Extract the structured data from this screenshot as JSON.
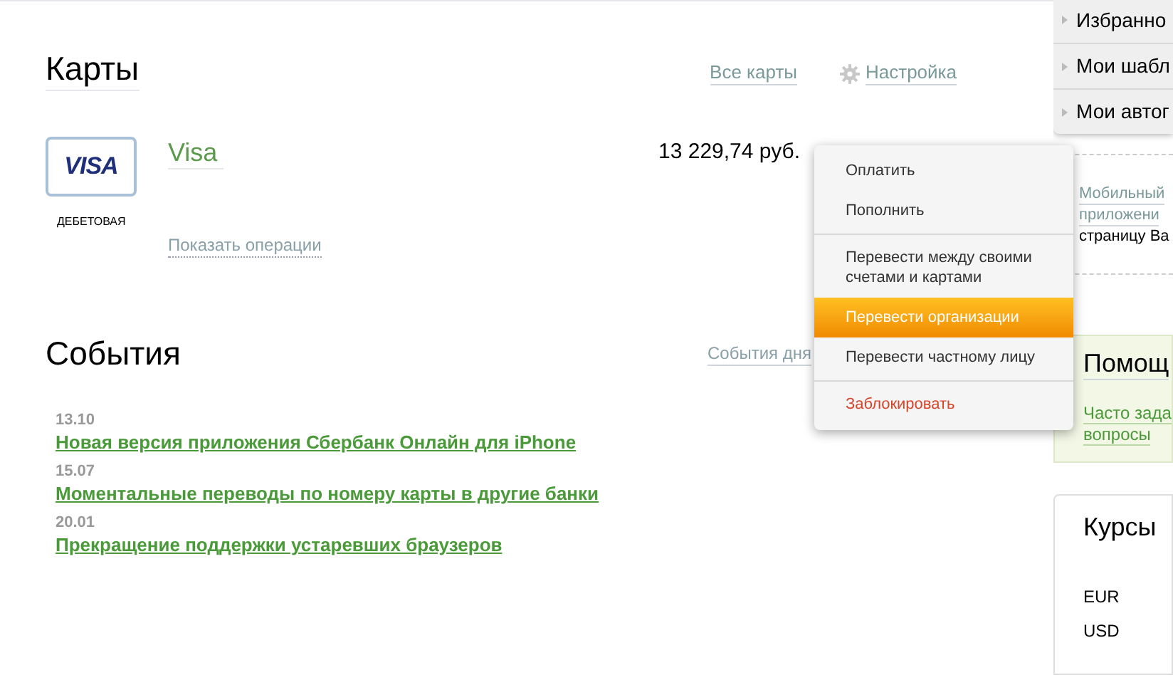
{
  "cards_section": {
    "title": "Карты",
    "links": [
      {
        "label": "Все карты",
        "kind": "plain"
      },
      {
        "label": "Настройка",
        "kind": "settings"
      }
    ],
    "cards": [
      {
        "brand_logo": "VISA",
        "name": "Visa",
        "type": "ДЕБЕТОВАЯ",
        "balance": "13 229,74 руб.",
        "operations_link": "Показать операции"
      }
    ]
  },
  "card_menu": {
    "groups": [
      [
        {
          "label": "Оплатить",
          "selected": false,
          "kind": "normal"
        },
        {
          "label": "Пополнить",
          "selected": false,
          "kind": "normal"
        }
      ],
      [
        {
          "label": "Перевести между своими счетами и картами",
          "selected": false,
          "kind": "normal"
        },
        {
          "label": "Перевести организации",
          "selected": true,
          "kind": "normal"
        },
        {
          "label": "Перевести частному лицу",
          "selected": false,
          "kind": "normal"
        }
      ],
      [
        {
          "label": "Заблокировать",
          "selected": false,
          "kind": "danger"
        }
      ]
    ]
  },
  "events_section": {
    "title": "События",
    "link": "События дня",
    "events": [
      {
        "date": "13.10",
        "title": "Новая версия приложения Сбербанк Онлайн для iPhone"
      },
      {
        "date": "15.07",
        "title": "Моментальные переводы по номеру карты в другие банки"
      },
      {
        "date": "20.01",
        "title": "Прекращение поддержки устаревших браузеров"
      }
    ]
  },
  "sidebar": {
    "nav_items": [
      "Избранно",
      "Мои шабл",
      "Мои автог"
    ],
    "mobile_promo": {
      "link_lines": [
        "Мобильный",
        "приложени"
      ],
      "text": "страницу Ва"
    },
    "help": {
      "title": "Помощ",
      "link_lines": [
        "Часто зада",
        "вопросы"
      ]
    },
    "rates": {
      "title": "Курсы",
      "currencies": [
        "EUR",
        "USD"
      ]
    }
  }
}
